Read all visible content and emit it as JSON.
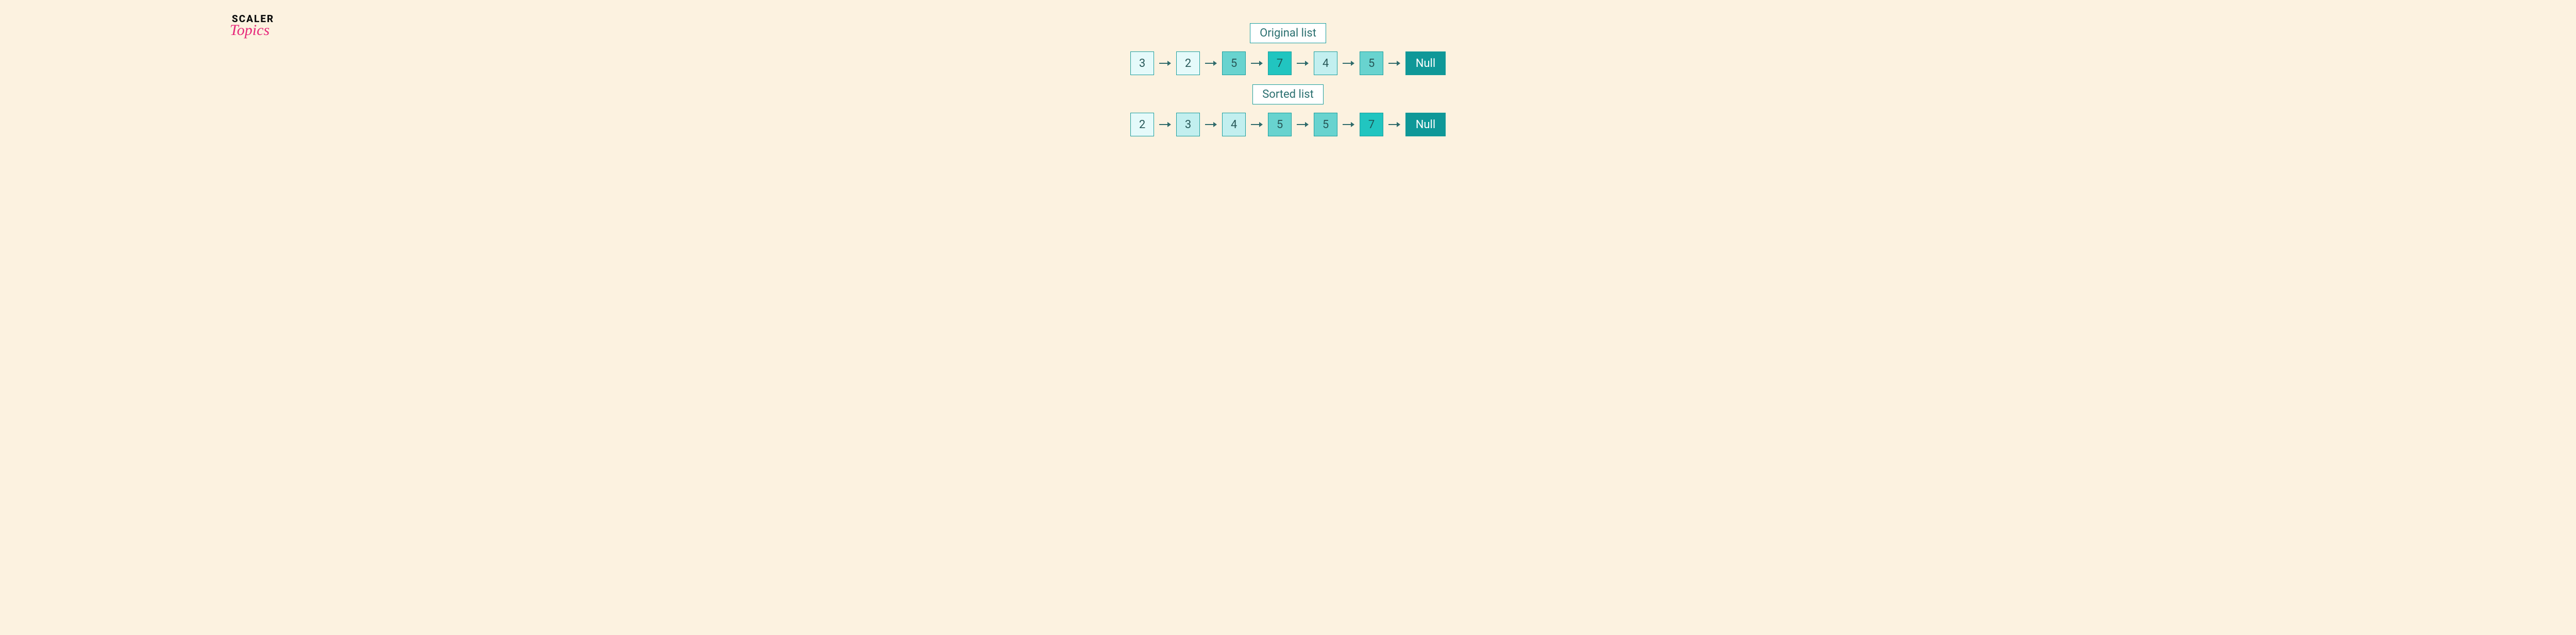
{
  "logo": {
    "line1": "SCALER",
    "line2": "Topics"
  },
  "lists": [
    {
      "title": "Original list",
      "nodes": [
        {
          "value": "3",
          "shade": "shade0"
        },
        {
          "value": "2",
          "shade": "shade0"
        },
        {
          "value": "5",
          "shade": "shade2"
        },
        {
          "value": "7",
          "shade": "shade3"
        },
        {
          "value": "4",
          "shade": "shade1"
        },
        {
          "value": "5",
          "shade": "shade2"
        }
      ],
      "terminal": "Null"
    },
    {
      "title": "Sorted list",
      "nodes": [
        {
          "value": "2",
          "shade": "shade0"
        },
        {
          "value": "3",
          "shade": "shade1"
        },
        {
          "value": "4",
          "shade": "shade1"
        },
        {
          "value": "5",
          "shade": "shade2"
        },
        {
          "value": "5",
          "shade": "shade2"
        },
        {
          "value": "7",
          "shade": "shade3"
        }
      ],
      "terminal": "Null"
    }
  ]
}
